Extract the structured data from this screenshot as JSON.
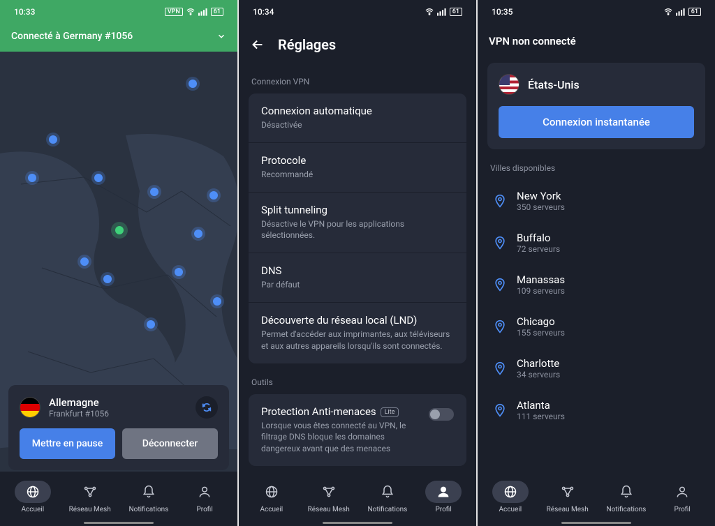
{
  "screen1": {
    "status_time": "10:33",
    "status_badges": [
      "VPN"
    ],
    "status_battery": "61",
    "header": "Connecté à Germany #1056",
    "country": "Allemagne",
    "server": "Frankfurt #1056",
    "pause_btn": "Mettre en pause",
    "disconnect_btn": "Déconnecter"
  },
  "screen2": {
    "status_time": "10:34",
    "status_battery": "61",
    "title": "Réglages",
    "section1": "Connexion VPN",
    "items": [
      {
        "title": "Connexion automatique",
        "sub": "Désactivée"
      },
      {
        "title": "Protocole",
        "sub": "Recommandé"
      },
      {
        "title": "Split tunneling",
        "sub": "Désactive le VPN pour les applications sélectionnées."
      },
      {
        "title": "DNS",
        "sub": "Par défaut"
      },
      {
        "title": "Découverte du réseau local (LND)",
        "sub": "Permet d'accéder aux imprimantes, aux téléviseurs et aux autres appareils lorsqu'ils sont connectés."
      }
    ],
    "section2": "Outils",
    "threat_title": "Protection Anti-menaces",
    "threat_badge": "Lite",
    "threat_sub": "Lorsque vous êtes connecté au VPN, le filtrage DNS bloque les domaines dangereux avant que des menaces"
  },
  "screen3": {
    "status_time": "10:35",
    "status_battery": "61",
    "header": "VPN non connecté",
    "country": "États-Unis",
    "connect_btn": "Connexion instantanée",
    "section": "Villes disponibles",
    "cities": [
      {
        "name": "New York",
        "sub": "350 serveurs"
      },
      {
        "name": "Buffalo",
        "sub": "72 serveurs"
      },
      {
        "name": "Manassas",
        "sub": "109 serveurs"
      },
      {
        "name": "Chicago",
        "sub": "155 serveurs"
      },
      {
        "name": "Charlotte",
        "sub": "34 serveurs"
      },
      {
        "name": "Atlanta",
        "sub": "111 serveurs"
      }
    ]
  },
  "nav": {
    "home": "Accueil",
    "mesh": "Réseau Mesh",
    "notif": "Notifications",
    "profile": "Profil"
  }
}
